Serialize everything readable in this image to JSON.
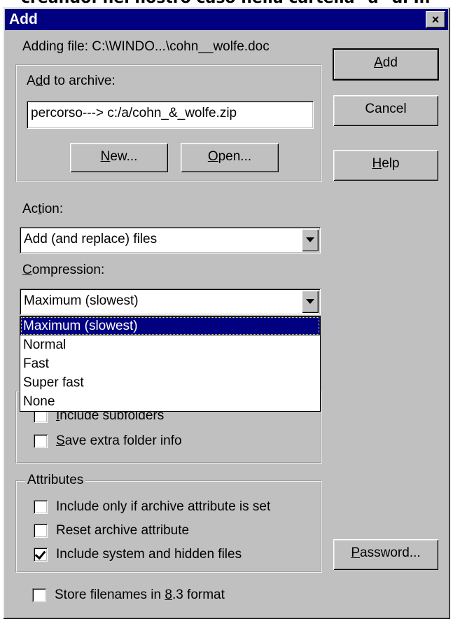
{
  "caption_top": "creando: nel nostro caso nella cartella \"a\" di In",
  "dialog": {
    "title": "Add",
    "close_label": "×",
    "adding_file": "Adding file: C:\\WINDO...\\cohn__wolfe.doc"
  },
  "buttons": {
    "add": {
      "pre": "",
      "key": "A",
      "post": "dd"
    },
    "cancel": "Cancel",
    "help": {
      "pre": "",
      "key": "H",
      "post": "elp"
    },
    "new": {
      "pre": "",
      "key": "N",
      "post": "ew..."
    },
    "open": {
      "pre": "",
      "key": "O",
      "post": "pen..."
    },
    "password": {
      "pre": "",
      "key": "P",
      "post": "assword..."
    }
  },
  "archive_group": {
    "label": {
      "pre": "A",
      "key": "d",
      "post": "d to archive:"
    },
    "path_value": "percorso--->    c:/a/cohn_&_wolfe.zip"
  },
  "action": {
    "label": {
      "pre": "Ac",
      "key": "t",
      "post": "ion:"
    },
    "selected": "Add (and replace) files"
  },
  "compression": {
    "label": {
      "pre": "",
      "key": "C",
      "post": "ompression:"
    },
    "selected": "Maximum (slowest)",
    "options": [
      "Maximum (slowest)",
      "Normal",
      "Fast",
      "Super fast",
      "None"
    ]
  },
  "folders_group": {
    "include_subfolders": {
      "pre": "",
      "key": "I",
      "post": "nclude subfolders",
      "checked": false
    },
    "save_folder_info": {
      "pre": "",
      "key": "S",
      "post": "ave extra folder info",
      "checked": false
    }
  },
  "attributes_group": {
    "title": "Attributes",
    "archive_attr_set": {
      "text": "Include only if archive attribute is set",
      "checked": false
    },
    "reset_archive_attr": {
      "text": "Reset archive attribute",
      "checked": false
    },
    "system_hidden": {
      "text": "Include system and hidden files",
      "checked": true
    }
  },
  "store_83": {
    "pre": "Store filenames in ",
    "key": "8",
    "post": ".3 format",
    "checked": false
  },
  "colors": {
    "titlebar": "#000080",
    "face": "#c0c0c0",
    "selection": "#000080"
  }
}
